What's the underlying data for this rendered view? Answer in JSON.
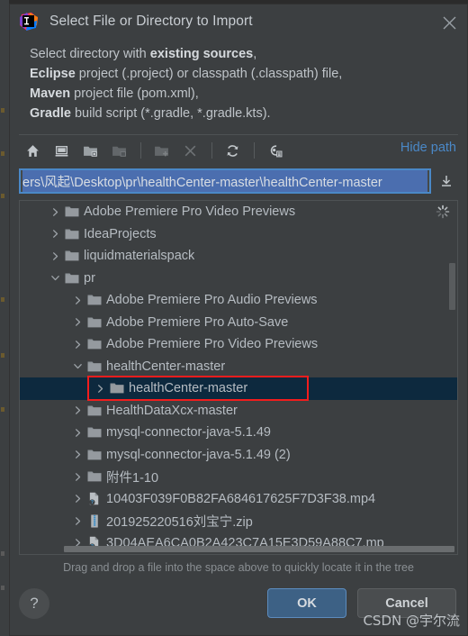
{
  "window": {
    "title": "Select File or Directory to Import",
    "app_icon": "intellij-idea-logo",
    "close_icon": "close-icon"
  },
  "description": {
    "line1_prefix": "Select directory with ",
    "line1_bold": "existing sources",
    "line1_suffix": ",",
    "line2_bold": "Eclipse",
    "line2_rest": " project (.project) or classpath (.classpath) file,",
    "line3_bold": "Maven",
    "line3_rest": " project file (pom.xml),",
    "line4_bold": "Gradle",
    "line4_rest": " build script (*.gradle, *.gradle.kts)."
  },
  "toolbar": {
    "buttons": [
      {
        "name": "home-icon",
        "tooltip": "Home",
        "enabled": true
      },
      {
        "name": "desktop-icon",
        "tooltip": "Desktop",
        "enabled": true
      },
      {
        "name": "project-folder-icon",
        "tooltip": "Project Directory",
        "enabled": true
      },
      {
        "name": "module-folder-icon",
        "tooltip": "Module Directory",
        "enabled": false
      },
      {
        "name": "new-folder-icon",
        "tooltip": "New Folder",
        "enabled": false
      },
      {
        "name": "delete-icon",
        "tooltip": "Delete",
        "enabled": false
      },
      {
        "name": "refresh-icon",
        "tooltip": "Refresh",
        "enabled": true
      },
      {
        "name": "show-hidden-files-icon",
        "tooltip": "Show Hidden Files and Directories",
        "enabled": true
      }
    ],
    "hide_path_label": "Hide path"
  },
  "path_field": {
    "value": "ers\\风起\\Desktop\\pr\\healthCenter-master\\healthCenter-master",
    "full_value": "C:\\Users\\风起\\Desktop\\pr\\healthCenter-master\\healthCenter-master",
    "selected": true,
    "dropdown_icon": "download-arrow-icon"
  },
  "tree": {
    "loading_icon": "loading-spinner-icon",
    "rows": [
      {
        "label": "Adobe Premiere Pro Video Previews",
        "indent": 1,
        "icon": "folder-icon",
        "arrow": "collapsed",
        "selected": false
      },
      {
        "label": "IdeaProjects",
        "indent": 1,
        "icon": "folder-icon",
        "arrow": "collapsed",
        "selected": false
      },
      {
        "label": "liquidmaterialspack",
        "indent": 1,
        "icon": "folder-icon",
        "arrow": "collapsed",
        "selected": false
      },
      {
        "label": "pr",
        "indent": 1,
        "icon": "folder-icon",
        "arrow": "expanded",
        "selected": false
      },
      {
        "label": "Adobe Premiere Pro Audio Previews",
        "indent": 2,
        "icon": "folder-icon",
        "arrow": "collapsed",
        "selected": false
      },
      {
        "label": "Adobe Premiere Pro Auto-Save",
        "indent": 2,
        "icon": "folder-icon",
        "arrow": "collapsed",
        "selected": false
      },
      {
        "label": "Adobe Premiere Pro Video Previews",
        "indent": 2,
        "icon": "folder-icon",
        "arrow": "collapsed",
        "selected": false
      },
      {
        "label": "healthCenter-master",
        "indent": 2,
        "icon": "folder-icon",
        "arrow": "expanded",
        "selected": false
      },
      {
        "label": "healthCenter-master",
        "indent": 3,
        "icon": "folder-icon",
        "arrow": "collapsed",
        "selected": true
      },
      {
        "label": "HealthDataXcx-master",
        "indent": 2,
        "icon": "folder-icon",
        "arrow": "collapsed",
        "selected": false
      },
      {
        "label": "mysql-connector-java-5.1.49",
        "indent": 2,
        "icon": "folder-icon",
        "arrow": "collapsed",
        "selected": false
      },
      {
        "label": "mysql-connector-java-5.1.49 (2)",
        "indent": 2,
        "icon": "folder-icon",
        "arrow": "collapsed",
        "selected": false
      },
      {
        "label": "附件1-10",
        "indent": 2,
        "icon": "folder-icon",
        "arrow": "collapsed",
        "selected": false
      },
      {
        "label": "10403F039F0B82FA684617625F7D3F38.mp4",
        "indent": 2,
        "icon": "unknown-file-icon",
        "arrow": "collapsed",
        "selected": false
      },
      {
        "label": "201925220516刘宝宁.zip",
        "indent": 2,
        "icon": "archive-file-icon",
        "arrow": "collapsed",
        "selected": false
      },
      {
        "label": "3D04AEA6CA0B2A423C7A15E3D59A88C7.mp",
        "indent": 2,
        "icon": "unknown-file-icon",
        "arrow": "collapsed",
        "selected": false
      }
    ]
  },
  "hint": "Drag and drop a file into the space above to quickly locate it in the tree",
  "footer": {
    "help_label": "?",
    "ok_label": "OK",
    "cancel_label": "Cancel"
  },
  "watermark": "CSDN @宇尔流",
  "colors": {
    "dialog_bg": "#3c3f41",
    "accent_blue": "#4a88c7",
    "selection_blue": "#4b6eaf",
    "row_selected_bg": "#0d293e",
    "annotation_red": "#f21d1d",
    "ok_button_bg": "#3d6185"
  }
}
